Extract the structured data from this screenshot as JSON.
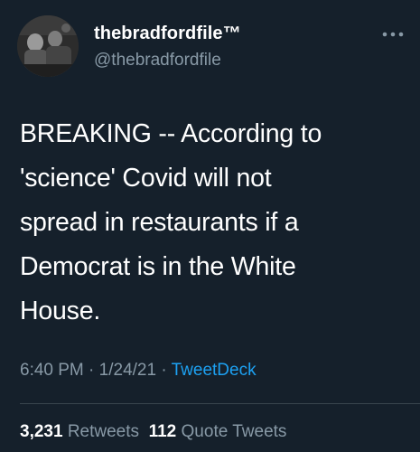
{
  "author": {
    "display_name": "thebradfordfile™",
    "handle": "@thebradfordfile"
  },
  "tweet": {
    "text": "BREAKING -- According to\n'science' Covid will not\nspread in restaurants if a\nDemocrat is in the White\nHouse."
  },
  "meta": {
    "time": "6:40 PM",
    "date": "1/24/21",
    "separator": " · ",
    "source": "TweetDeck"
  },
  "stats": {
    "retweets_count": "3,231",
    "retweets_label": "Retweets",
    "quote_count": "112",
    "quote_label": "Quote Tweets"
  },
  "icons": {
    "more": "more-icon"
  },
  "colors": {
    "background": "#15202b",
    "text": "#ffffff",
    "secondary_text": "#8899a6",
    "accent": "#1da1f2",
    "divider": "#38444d"
  }
}
